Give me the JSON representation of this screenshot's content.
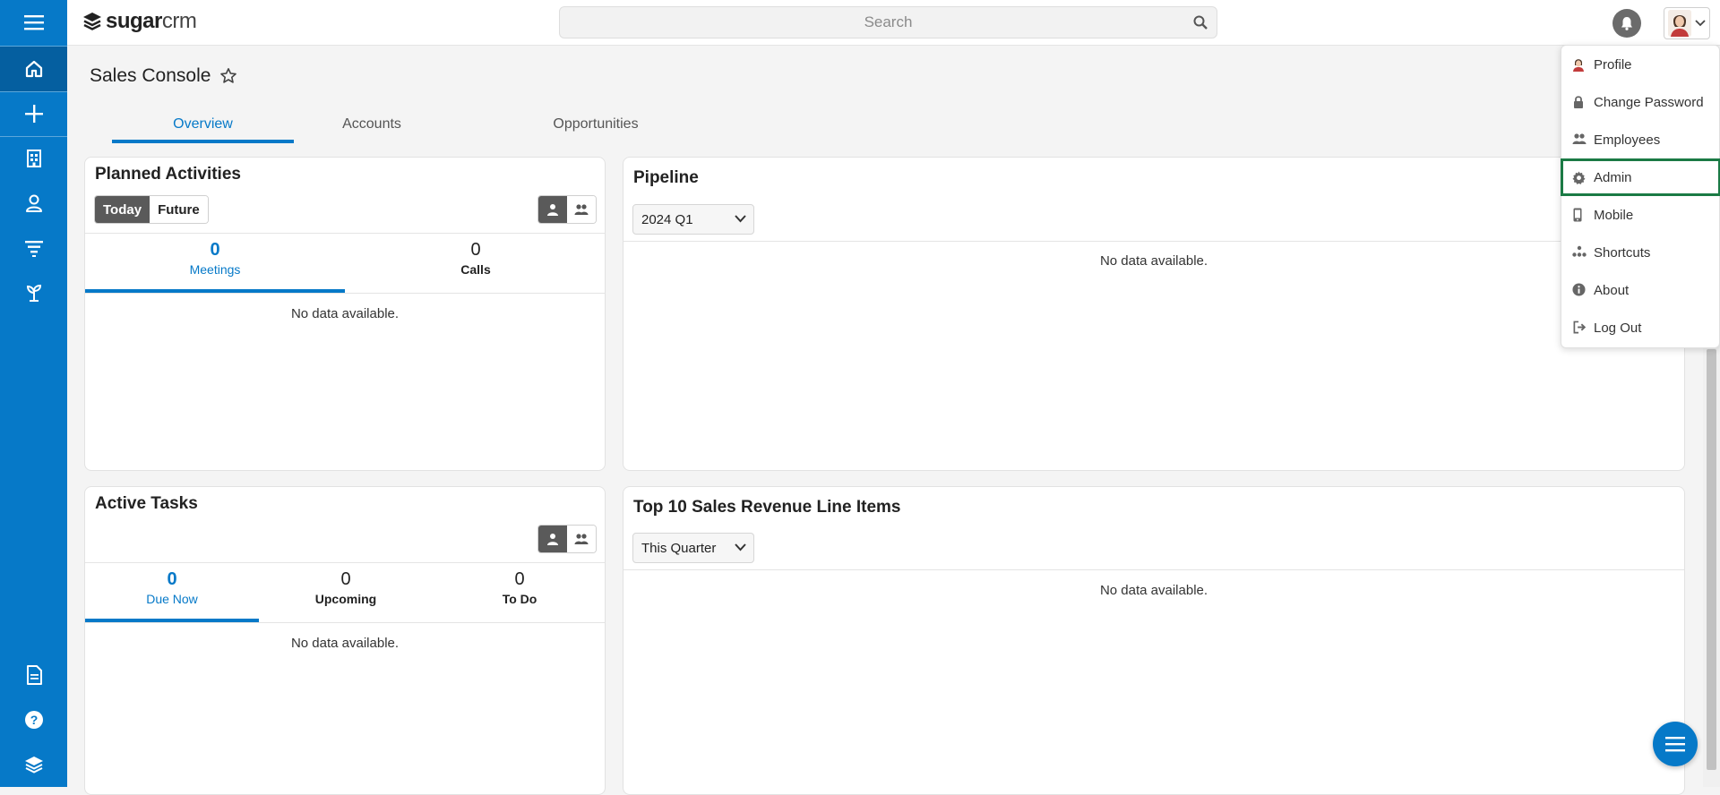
{
  "header": {
    "logo_bold": "sugar",
    "logo_light": "crm",
    "search_placeholder": "Search"
  },
  "page": {
    "title": "Sales Console",
    "tabs": [
      "Overview",
      "Accounts",
      "Opportunities"
    ],
    "active_tab": "Overview"
  },
  "planned_activities": {
    "title": "Planned Activities",
    "toggle": [
      "Today",
      "Future"
    ],
    "counts": [
      {
        "value": "0",
        "label": "Meetings"
      },
      {
        "value": "0",
        "label": "Calls"
      }
    ],
    "empty": "No data available."
  },
  "pipeline": {
    "title": "Pipeline",
    "select": "2024 Q1",
    "empty": "No data available."
  },
  "active_tasks": {
    "title": "Active Tasks",
    "counts": [
      {
        "value": "0",
        "label": "Due Now"
      },
      {
        "value": "0",
        "label": "Upcoming"
      },
      {
        "value": "0",
        "label": "To Do"
      }
    ],
    "empty": "No data available."
  },
  "top_sales": {
    "title": "Top 10 Sales Revenue Line Items",
    "select": "This Quarter",
    "empty": "No data available."
  },
  "user_menu": {
    "items": [
      {
        "label": "Profile",
        "icon": "profile-icon"
      },
      {
        "label": "Change Password",
        "icon": "lock-icon"
      },
      {
        "label": "Employees",
        "icon": "employees-icon"
      },
      {
        "label": "Admin",
        "icon": "gear-icon"
      },
      {
        "label": "Mobile",
        "icon": "mobile-icon"
      },
      {
        "label": "Shortcuts",
        "icon": "shortcuts-icon"
      },
      {
        "label": "About",
        "icon": "info-icon"
      },
      {
        "label": "Log Out",
        "icon": "logout-icon"
      }
    ],
    "highlighted": "Admin"
  },
  "colors": {
    "brand": "#0679c8",
    "highlight_border": "#1b7a45"
  }
}
